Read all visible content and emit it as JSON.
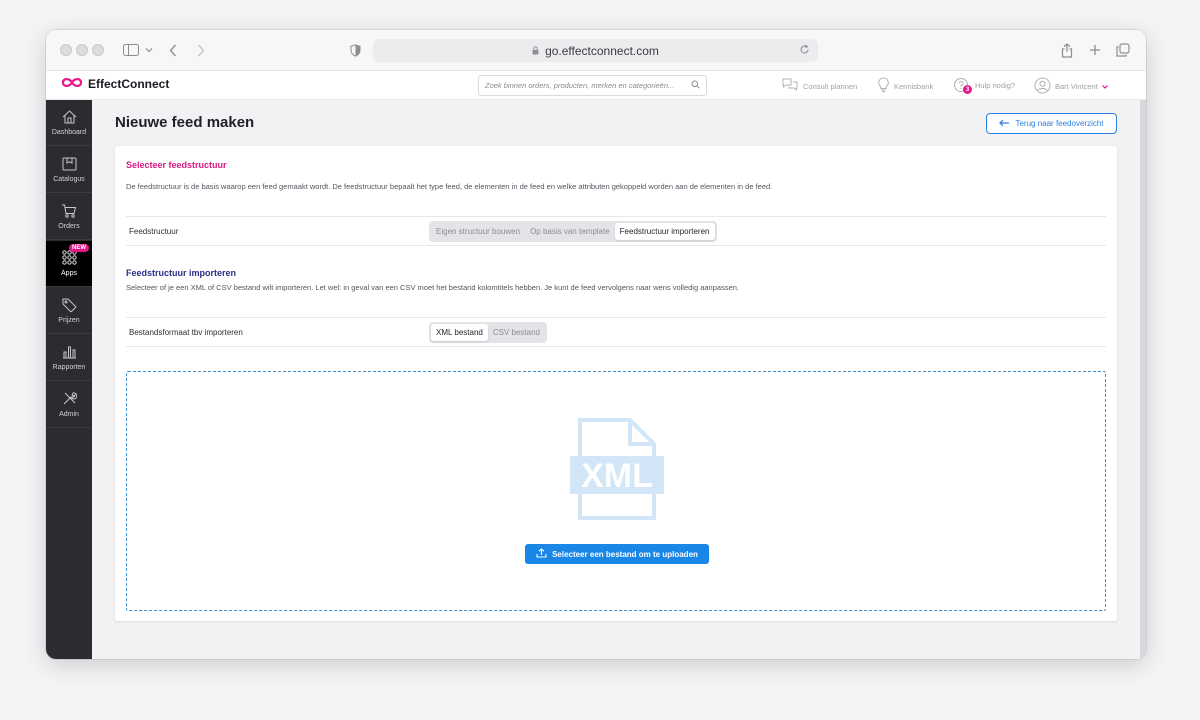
{
  "browser": {
    "url": "go.effectconnect.com"
  },
  "header": {
    "brand": "EffectConnect",
    "search_placeholder": "Zoek binnen orders, producten, merken en categorieën...",
    "consult": "Consult plannen",
    "knowledge": "Kennisbank",
    "help": "Hulp nodig?",
    "help_badge": "3",
    "user": "Bart Vintcent"
  },
  "sidebar": {
    "items": [
      {
        "label": "Dashboard",
        "icon": "home-icon"
      },
      {
        "label": "Catalogus",
        "icon": "box-icon"
      },
      {
        "label": "Orders",
        "icon": "cart-icon"
      },
      {
        "label": "Apps",
        "icon": "apps-grid-icon",
        "badge": "NEW",
        "active": true
      },
      {
        "label": "Prijzen",
        "icon": "price-tag-icon"
      },
      {
        "label": "Rapporten",
        "icon": "bar-chart-icon"
      },
      {
        "label": "Admin",
        "icon": "tools-icon"
      }
    ]
  },
  "page": {
    "title": "Nieuwe feed maken",
    "back_button": "Terug naar feedoverzicht"
  },
  "structure": {
    "title": "Selecteer feedstructuur",
    "description": "De feedstructuur is de basis waarop een feed gemaakt wordt. De feedstructuur bepaalt het type feed, de elementen in de feed en welke attributen gekoppeld worden aan de elementen in de feed.",
    "row_label": "Feedstructuur",
    "options": [
      "Eigen structuur bouwen",
      "Op basis van template",
      "Feedstructuur importeren"
    ],
    "selected": "Feedstructuur importeren"
  },
  "import": {
    "title": "Feedstructuur importeren",
    "description": "Selecteer of je een XML of CSV bestand wilt importeren. Let wel: in geval van een CSV moet het bestand kolomtitels hebben. Je kunt de feed vervolgens naar wens volledig aanpassen.",
    "row_label": "Bestandsformaat tbv importeren",
    "options": [
      "XML bestand",
      "CSV bestand"
    ],
    "selected": "XML bestand"
  },
  "upload": {
    "file_type_label": "XML",
    "button": "Selecteer een bestand om te uploaden"
  },
  "colors": {
    "accent": "#1a86e6",
    "brand_pink": "#e5168a",
    "section_pink": "#d6197f",
    "section_navy": "#2b2f86",
    "sidebar_bg": "#2c2c30"
  }
}
